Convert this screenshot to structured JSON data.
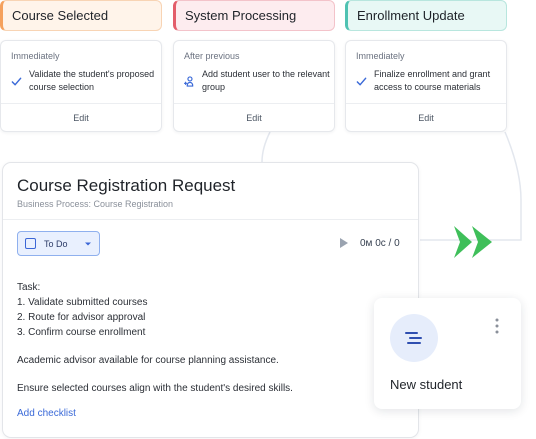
{
  "steps": [
    {
      "title": "Course Selected",
      "timing": "Immediately",
      "action": "Validate the student's proposed course selection",
      "action_icon": "check-icon",
      "edit_label": "Edit",
      "accent": "#f5a15d",
      "fill": "#fff4ea"
    },
    {
      "title": "System Processing",
      "timing": "After previous",
      "action": "Add student user to the relevant group",
      "action_icon": "add-user-icon",
      "edit_label": "Edit",
      "accent": "#e35d6a",
      "fill": "#fdecef"
    },
    {
      "title": "Enrollment Update",
      "timing": "Immediately",
      "action": "Finalize enrollment and grant access to course materials",
      "action_icon": "check-icon",
      "edit_label": "Edit",
      "accent": "#4fc2b2",
      "fill": "#e8f8f5"
    }
  ],
  "task": {
    "title": "Course Registration Request",
    "subtitle": "Business Process: Course Registration",
    "status": "To Do",
    "timer": "0м 0с / 0",
    "lines": [
      "Task:",
      "1. Validate submitted courses",
      "2. Route for advisor approval",
      "3. Confirm course enrollment"
    ],
    "note1": "Academic advisor available for course planning assistance.",
    "note2": "Ensure selected courses align with the student's desired skills.",
    "add_checklist": "Add checklist"
  },
  "student": {
    "label": "New student",
    "icon": "list-icon"
  },
  "colors": {
    "accent_blue": "#3b6ad8",
    "arrow_green": "#3fbf5a"
  }
}
